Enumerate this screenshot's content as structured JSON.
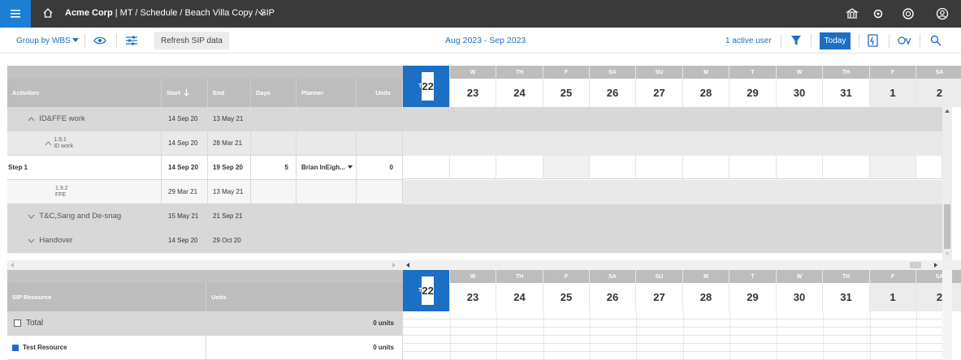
{
  "topbar": {
    "company": "Acme Corp",
    "path": " | MT / Schedule / Beach Villa Copy / SIP"
  },
  "toolbar": {
    "group_by": "Group by WBS",
    "refresh": "Refresh SIP data",
    "date_range": "Aug 2023 - Sep 2023",
    "active_users": "1 active user",
    "today": "Today"
  },
  "activities": {
    "headers": [
      "Activities",
      "Start",
      "End",
      "Days",
      "Planner",
      "Units"
    ],
    "rows": [
      {
        "name": "ID&FFE work",
        "start": "14 Sep 20",
        "end": "13 May 21"
      },
      {
        "code": "1.9.1",
        "sub": "ID work",
        "start": "14 Sep 20",
        "end": "28 Mar 21"
      },
      {
        "name": "Step 1",
        "start": "14 Sep 20",
        "end": "19 Sep 20",
        "days": "5",
        "planner": "Brian InEigh...",
        "units": "0"
      },
      {
        "code": "1.9.2",
        "sub": "FFE",
        "start": "29 Mar 21",
        "end": "13 May 21"
      },
      {
        "name": "T&C,Sang and De-snag",
        "start": "15 May 21",
        "end": "21 Sep 21"
      },
      {
        "name": "Handover",
        "start": "14 Sep 20",
        "end": "29 Oct 20"
      }
    ]
  },
  "calendar": {
    "days": [
      {
        "label": "T",
        "num": "22"
      },
      {
        "label": "W",
        "num": "23"
      },
      {
        "label": "TH",
        "num": "24"
      },
      {
        "label": "F",
        "num": "25"
      },
      {
        "label": "SA",
        "num": "26"
      },
      {
        "label": "SU",
        "num": "27"
      },
      {
        "label": "M",
        "num": "28"
      },
      {
        "label": "T",
        "num": "29"
      },
      {
        "label": "W",
        "num": "30"
      },
      {
        "label": "TH",
        "num": "31"
      },
      {
        "label": "F",
        "num": "1"
      },
      {
        "label": "SA",
        "num": "2"
      }
    ]
  },
  "sip": {
    "headers": [
      "SIP Resource",
      "Units"
    ],
    "total_label": "Total",
    "total_units": "0 units",
    "resource_label": "Test Resource",
    "resource_units": "0 units",
    "resource_color": "#1b6fc4"
  }
}
